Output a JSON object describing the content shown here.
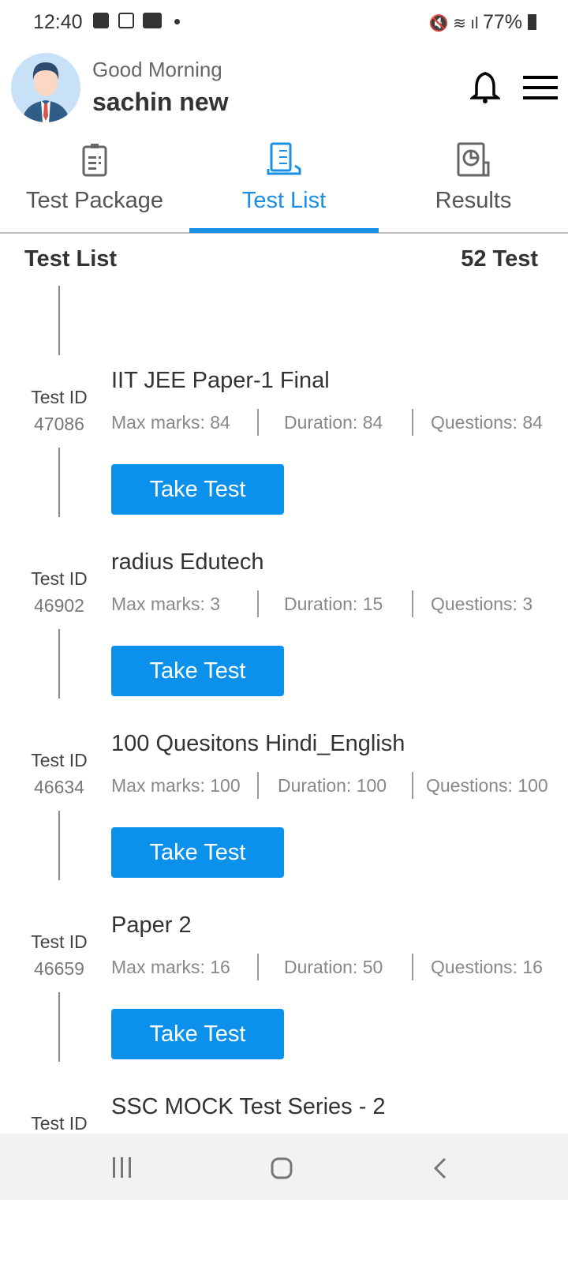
{
  "status_bar": {
    "time": "12:40",
    "battery": "77%"
  },
  "header": {
    "greeting": "Good Morning",
    "user_name": "sachin new"
  },
  "tabs": [
    {
      "label": "Test Package",
      "active": false
    },
    {
      "label": "Test List",
      "active": true
    },
    {
      "label": "Results",
      "active": false
    }
  ],
  "list": {
    "heading": "Test List",
    "count": "52 Test",
    "id_label": "Test ID",
    "button_label": "Take Test",
    "items": [
      {
        "id": "47086",
        "title": "IIT JEE Paper-1 Final",
        "max_marks": "Max marks: 84",
        "duration": "Duration: 84",
        "questions": "Questions: 84"
      },
      {
        "id": "46902",
        "title": "radius Edutech",
        "max_marks": "Max marks: 3",
        "duration": "Duration: 15",
        "questions": "Questions: 3"
      },
      {
        "id": "46634",
        "title": "100 Quesitons Hindi_English",
        "max_marks": "Max marks: 100",
        "duration": "Duration: 100",
        "questions": "Questions: 100"
      },
      {
        "id": "46659",
        "title": "Paper  2",
        "max_marks": "Max marks: 16",
        "duration": "Duration: 50",
        "questions": "Questions: 16"
      },
      {
        "id": "",
        "title": "SSC MOCK Test Series - 2",
        "max_marks": "",
        "duration": "",
        "questions": ""
      }
    ]
  },
  "colors": {
    "accent": "#1a8fe3",
    "button": "#0b91ec"
  }
}
